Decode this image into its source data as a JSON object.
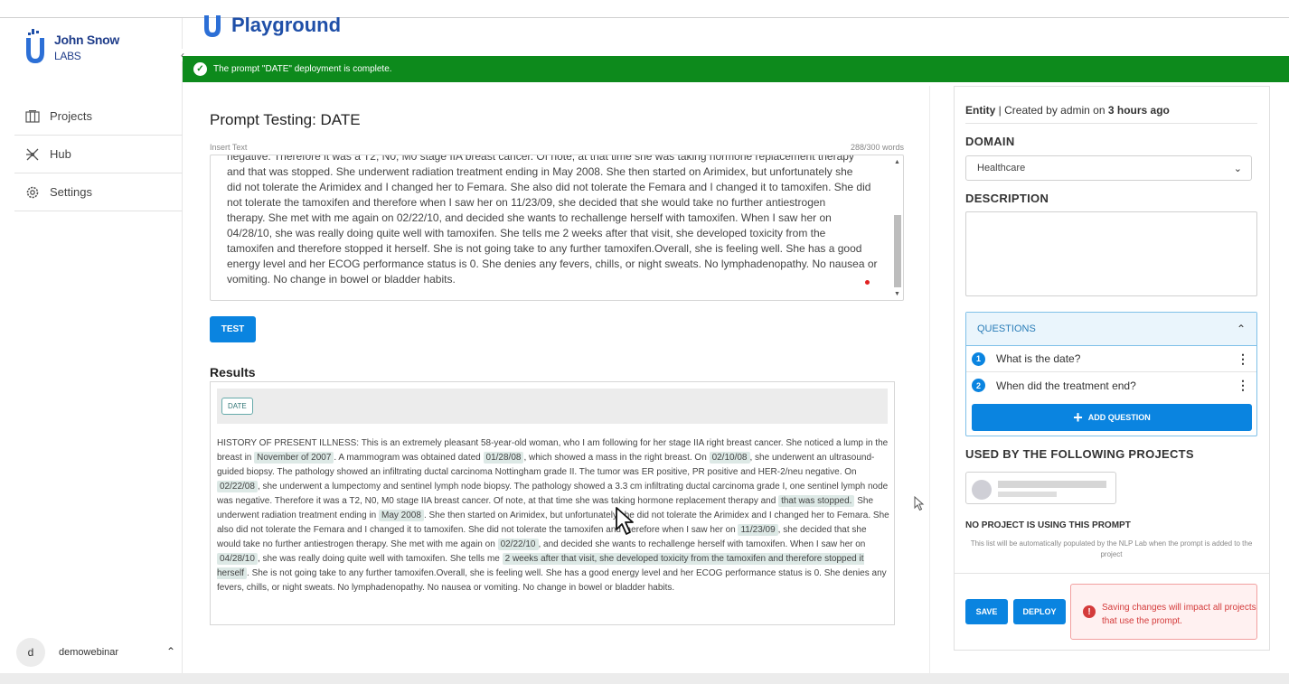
{
  "brand": {
    "line1": "John Snow",
    "line2": "LABS"
  },
  "header": {
    "title": "Playground"
  },
  "toast": {
    "message": "The prompt \"DATE\" deployment is complete."
  },
  "sidebar": {
    "items": [
      {
        "label": "Projects",
        "icon": "projects-icon"
      },
      {
        "label": "Hub",
        "icon": "hub-icon"
      },
      {
        "label": "Settings",
        "icon": "gear-icon"
      }
    ],
    "user": {
      "initial": "d",
      "name": "demowebinar"
    }
  },
  "main": {
    "title": "Prompt Testing: DATE",
    "insert_label": "Insert Text",
    "word_count": "288/300 words",
    "input_text": [
      "negative. Therefore it was a T2, N0, M0 stage IIA breast cancer. Of note, at that time she was taking hormone replacement therapy",
      "and that was stopped. She underwent radiation treatment ending in May 2008. She then started on Arimidex, but unfortunately she",
      "did not tolerate the Arimidex and I changed her to Femara. She also did not tolerate the Femara and I changed it to tamoxifen. She did",
      "not tolerate the tamoxifen and therefore when I saw her on 11/23/09, she decided that she would take no further antiestrogen",
      "therapy. She met with me again on 02/22/10, and decided she wants to rechallenge herself with tamoxifen. When I saw her on",
      "04/28/10, she was really doing quite well with tamoxifen. She tells me 2 weeks after that visit, she developed toxicity from the",
      "tamoxifen and therefore stopped it herself. She is not going take to any further tamoxifen.Overall, she is feeling well. She has a good",
      "energy level and her ECOG performance status is 0. She denies any fevers, chills, or night sweats. No lymphadenopathy. No nausea or",
      "vomiting. No change in bowel or bladder habits."
    ],
    "test_label": "TEST",
    "results_label": "Results",
    "tag": "DATE",
    "results_segments": [
      {
        "t": "HISTORY OF PRESENT ILLNESS: This is an extremely pleasant 58-year-old woman, who I am following for her stage IIA right breast cancer. She noticed a lump in the breast in ",
        "h": false
      },
      {
        "t": "November of 2007",
        "h": true
      },
      {
        "t": ". A mammogram was obtained dated ",
        "h": false
      },
      {
        "t": "01/28/08",
        "h": true
      },
      {
        "t": ", which showed a mass in the right breast. On ",
        "h": false
      },
      {
        "t": "02/10/08",
        "h": true
      },
      {
        "t": ", she underwent an ultrasound-guided biopsy. The pathology showed an infiltrating ductal carcinoma Nottingham grade II. The tumor was ER positive, PR positive and HER-2/neu negative. On ",
        "h": false
      },
      {
        "t": "02/22/08",
        "h": true
      },
      {
        "t": ", she underwent a lumpectomy and sentinel lymph node biopsy. The pathology showed a 3.3 cm infiltrating ductal carcinoma grade I, one sentinel lymph node was negative. Therefore it was a T2, N0, M0 stage IIA breast cancer. Of note, at that time she was taking hormone replacement therapy and ",
        "h": false
      },
      {
        "t": "that was stopped.",
        "h": true
      },
      {
        "t": " She underwent radiation treatment ending in ",
        "h": false
      },
      {
        "t": "May 2008",
        "h": true
      },
      {
        "t": ". She then started on Arimidex, but unfortunately she did not tolerate the Arimidex and I changed her to Femara. She also did not tolerate the Femara and I changed it to tamoxifen. She did not tolerate the tamoxifen and therefore when I saw her on ",
        "h": false
      },
      {
        "t": "11/23/09",
        "h": true
      },
      {
        "t": ", she decided that she would take no further antiestrogen therapy. She met with me again on ",
        "h": false
      },
      {
        "t": "02/22/10",
        "h": true
      },
      {
        "t": ", and decided she wants to rechallenge herself with tamoxifen. When I saw her on ",
        "h": false
      },
      {
        "t": "04/28/10",
        "h": true
      },
      {
        "t": ", she was really doing quite well with tamoxifen. She tells me ",
        "h": false
      },
      {
        "t": "2 weeks after that visit, she developed toxicity from the tamoxifen and therefore stopped it herself",
        "h": true
      },
      {
        "t": ". She is not going take to any further tamoxifen.Overall, she is feeling well. She has a good energy level and her ECOG performance status is 0. She denies any fevers, chills, or night sweats. No lymphadenopathy. No nausea or vomiting. No change in bowel or bladder habits.",
        "h": false
      }
    ]
  },
  "panel": {
    "meta_type": "Entity",
    "meta_rest": " | Created by admin on ",
    "meta_time": "3 hours ago",
    "domain_label": "DOMAIN",
    "domain_value": "Healthcare",
    "description_label": "DESCRIPTION",
    "questions_label": "QUESTIONS",
    "questions": [
      {
        "num": "1",
        "text": "What is the date?"
      },
      {
        "num": "2",
        "text": "When did the treatment end?"
      }
    ],
    "add_question": "ADD QUESTION",
    "used_by_label": "USED BY THE FOLLOWING PROJECTS",
    "no_project": "NO PROJECT IS USING THIS PROMPT",
    "note": "This list will be automatically populated by the NLP Lab when the prompt is added to the project",
    "save": "SAVE",
    "deploy": "DEPLOY",
    "warning": "Saving changes will impact all projects that use the prompt."
  },
  "colors": {
    "primary": "#0a84e0",
    "success": "#0d8a1c",
    "brand": "#1f4fa8",
    "danger": "#d43b3b",
    "highlight": "#dde9e6"
  }
}
